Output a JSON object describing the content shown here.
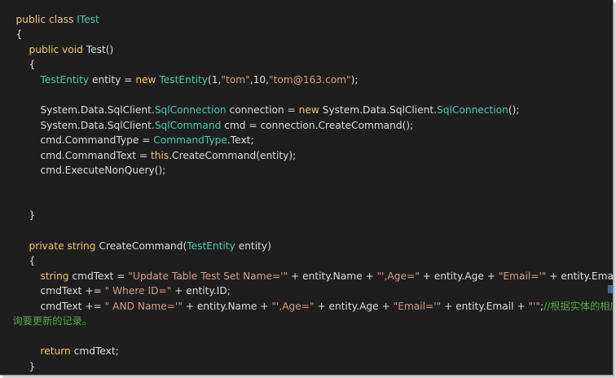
{
  "code": {
    "l1": {
      "kw": "public class ",
      "type": "ITest"
    },
    "l2": {
      "brace": "{"
    },
    "l3": {
      "kw": "public void ",
      "name": "Test()"
    },
    "l4": {
      "brace": "{"
    },
    "l5": {
      "type1": "TestEntity",
      "t1": " entity = ",
      "kw": "new ",
      "type2": "TestEntity",
      "t2": "(1,",
      "s1": "\"tom\"",
      "t3": ",10,",
      "s2": "\"tom@163.com\"",
      "t4": ");"
    },
    "l6": {
      "t1": "System.Data.SqlClient.",
      "type1": "SqlConnection",
      "t2": " connection = ",
      "kw": "new ",
      "t3": "System.Data.SqlClient.",
      "type2": "SqlConnection",
      "t4": "();"
    },
    "l7": {
      "t1": "System.Data.SqlClient.",
      "type1": "SqlCommand",
      "t2": " cmd = connection.CreateCommand();"
    },
    "l8": {
      "t1": "cmd.CommandType = ",
      "type": "CommandType",
      "t2": ".Text;"
    },
    "l9": {
      "t1": "cmd.CommandText = ",
      "kw": "this",
      "t2": ".CreateCommand(entity);"
    },
    "l10": {
      "t1": "cmd.ExecuteNonQuery();"
    },
    "l11": {
      "brace": "}"
    },
    "l12": {
      "kw1": "private ",
      "kw2": "string ",
      "t1": "CreateCommand(",
      "type": "TestEntity",
      "t2": " entity)"
    },
    "l13": {
      "brace": "{"
    },
    "l14": {
      "kw": "string ",
      "t1": "cmdText = ",
      "s1": "\"Update Table Test Set Name='\"",
      "t2": " + entity.Name + ",
      "s2": "\"',Age=\"",
      "t3": " + entity.Age + ",
      "s3": "\"Email='\"",
      "t4": " + entity.Email + ",
      "s4": "\"'\"",
      "t5": ";"
    },
    "l15": {
      "t1": "cmdText += ",
      "s1": "\" Where ID=\"",
      "t2": " + entity.ID;"
    },
    "l16": {
      "t1": "cmdText += ",
      "s1": "\" AND Name='\"",
      "t2": " + entity.Name + ",
      "s2": "\"',Age=\"",
      "t3": " + entity.Age + ",
      "s3": "\"Email='\"",
      "t4": " + entity.Email + ",
      "s4": "\"'\"",
      "t5": ";",
      "c1": "//根据实体的相应信息来"
    },
    "l17": {
      "c1": "询要更新的记录。"
    },
    "l18": {
      "kw": "return ",
      "t1": "cmdText;"
    },
    "l19": {
      "brace": "}"
    },
    "l20": {
      "brace": "}"
    }
  }
}
